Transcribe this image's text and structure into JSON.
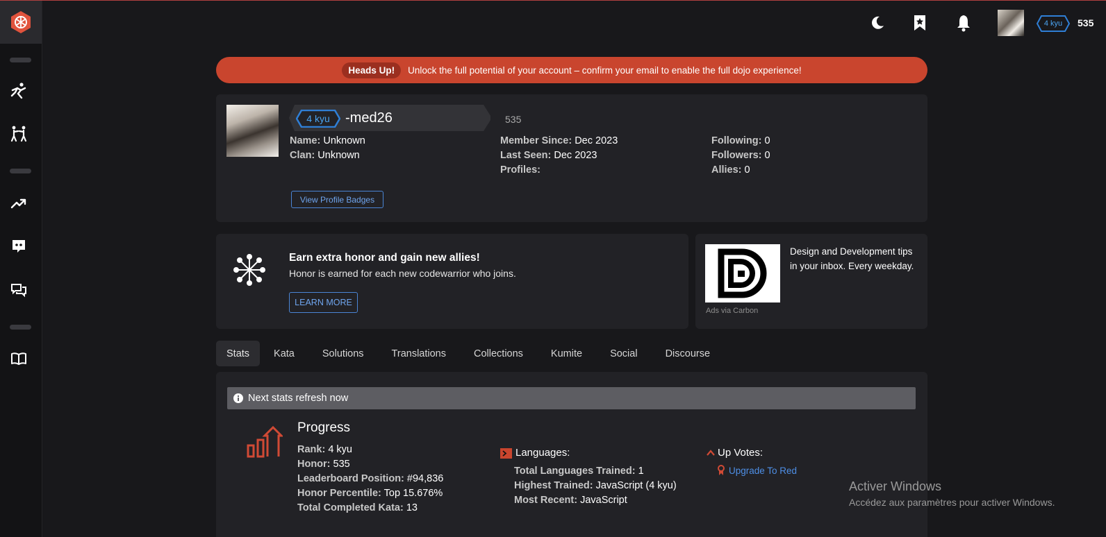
{
  "topbar": {
    "rank": "4 kyu",
    "honor": "535"
  },
  "banner": {
    "tag": "Heads Up!",
    "message": "Unlock the full potential of your account – confirm your email to enable the full dojo experience!"
  },
  "profile": {
    "rank": "4 kyu",
    "username": "-med26",
    "honor": "535",
    "name_label": "Name:",
    "name_value": "Unknown",
    "clan_label": "Clan:",
    "clan_value": "Unknown",
    "member_since_label": "Member Since:",
    "member_since_value": "Dec 2023",
    "last_seen_label": "Last Seen:",
    "last_seen_value": "Dec 2023",
    "profiles_label": "Profiles:",
    "following_label": "Following:",
    "following_value": "0",
    "followers_label": "Followers:",
    "followers_value": "0",
    "allies_label": "Allies:",
    "allies_value": "0",
    "badges_button": "View Profile Badges"
  },
  "promo": {
    "title": "Earn extra honor and gain new allies!",
    "subtitle": "Honor is earned for each new codewarrior who joins.",
    "button": "LEARN MORE"
  },
  "ad": {
    "text": "Design and Development tips in your inbox. Every weekday.",
    "via": "Ads via Carbon"
  },
  "tabs": [
    "Stats",
    "Kata",
    "Solutions",
    "Translations",
    "Collections",
    "Kumite",
    "Social",
    "Discourse"
  ],
  "stats": {
    "refresh": "Next stats refresh now",
    "progress_title": "Progress",
    "rank_label": "Rank:",
    "rank_value": "4 kyu",
    "honor_label": "Honor:",
    "honor_value": "535",
    "leaderboard_label": "Leaderboard Position:",
    "leaderboard_value": "#94,836",
    "percentile_label": "Honor Percentile:",
    "percentile_value": "Top 15.676%",
    "completed_label": "Total Completed Kata:",
    "completed_value": "13",
    "languages_title": "Languages:",
    "lang_trained_label": "Total Languages Trained:",
    "lang_trained_value": "1",
    "highest_label": "Highest Trained:",
    "highest_value": "JavaScript (4 kyu)",
    "recent_label": "Most Recent:",
    "recent_value": "JavaScript",
    "upvotes_title": "Up Votes:",
    "upgrade_link": "Upgrade To Red"
  },
  "watermark": {
    "title": "Activer Windows",
    "subtitle": "Accédez aux paramètres pour activer Windows."
  },
  "colors": {
    "background": "#18181b",
    "card": "#222226",
    "banner": "#c9452e",
    "accent_blue": "#4aa3f0",
    "brand_red": "#e0533d"
  },
  "icons": {
    "sidebar": [
      "training-icon",
      "kumite-icon",
      "leaderboard-icon",
      "discord-icon",
      "discussions-icon",
      "docs-icon"
    ],
    "topbar": [
      "moon-icon",
      "bookmark-icon",
      "bell-icon"
    ]
  }
}
